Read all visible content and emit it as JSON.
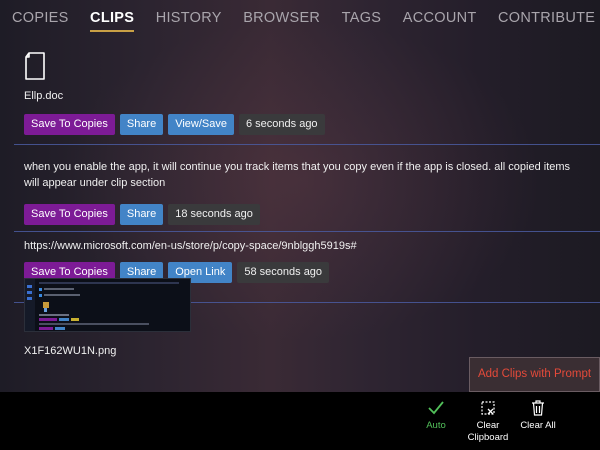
{
  "tabs": [
    {
      "label": "COPIES",
      "active": false
    },
    {
      "label": "CLIPS",
      "active": true
    },
    {
      "label": "HISTORY",
      "active": false
    },
    {
      "label": "BROWSER",
      "active": false
    },
    {
      "label": "TAGS",
      "active": false
    },
    {
      "label": "ACCOUNT",
      "active": false
    },
    {
      "label": "CONTRIBUTE",
      "active": false
    }
  ],
  "clips": {
    "file": {
      "icon": "document-icon",
      "name": "Ellp.doc",
      "save_label": "Save To Copies",
      "share_label": "Share",
      "action_label": "View/Save",
      "time": "6 seconds ago"
    },
    "text": {
      "content": "when you enable the app, it will continue you track items that you copy even if the app is closed. all copied items will appear under clip section",
      "save_label": "Save To Copies",
      "share_label": "Share",
      "time": "18 seconds ago"
    },
    "link": {
      "content": "https://www.microsoft.com/en-us/store/p/copy-space/9nblggh5919s#",
      "save_label": "Save To Copies",
      "share_label": "Share",
      "action_label": "Open Link",
      "time": "58 seconds ago"
    },
    "image": {
      "name": "X1F162WU1N.png"
    }
  },
  "prompt": {
    "label": "Add Clips with Prompt"
  },
  "bottom_bar": {
    "auto": {
      "label": "Auto",
      "icon": "check-icon",
      "color": "#52c05a"
    },
    "clear_clipboard": {
      "label_line1": "Clear",
      "label_line2": "Clipboard",
      "icon": "clear-clipboard-icon"
    },
    "clear_all": {
      "label": "Clear All",
      "icon": "trash-icon"
    }
  },
  "colors": {
    "save_button": "#7d1b96",
    "share_button": "#4284c7",
    "timestamp_bg": "#3a3a3c",
    "active_tab_underline": "#c9a045",
    "prompt_text": "#e44a3a",
    "separator": "#4a5aa0"
  }
}
